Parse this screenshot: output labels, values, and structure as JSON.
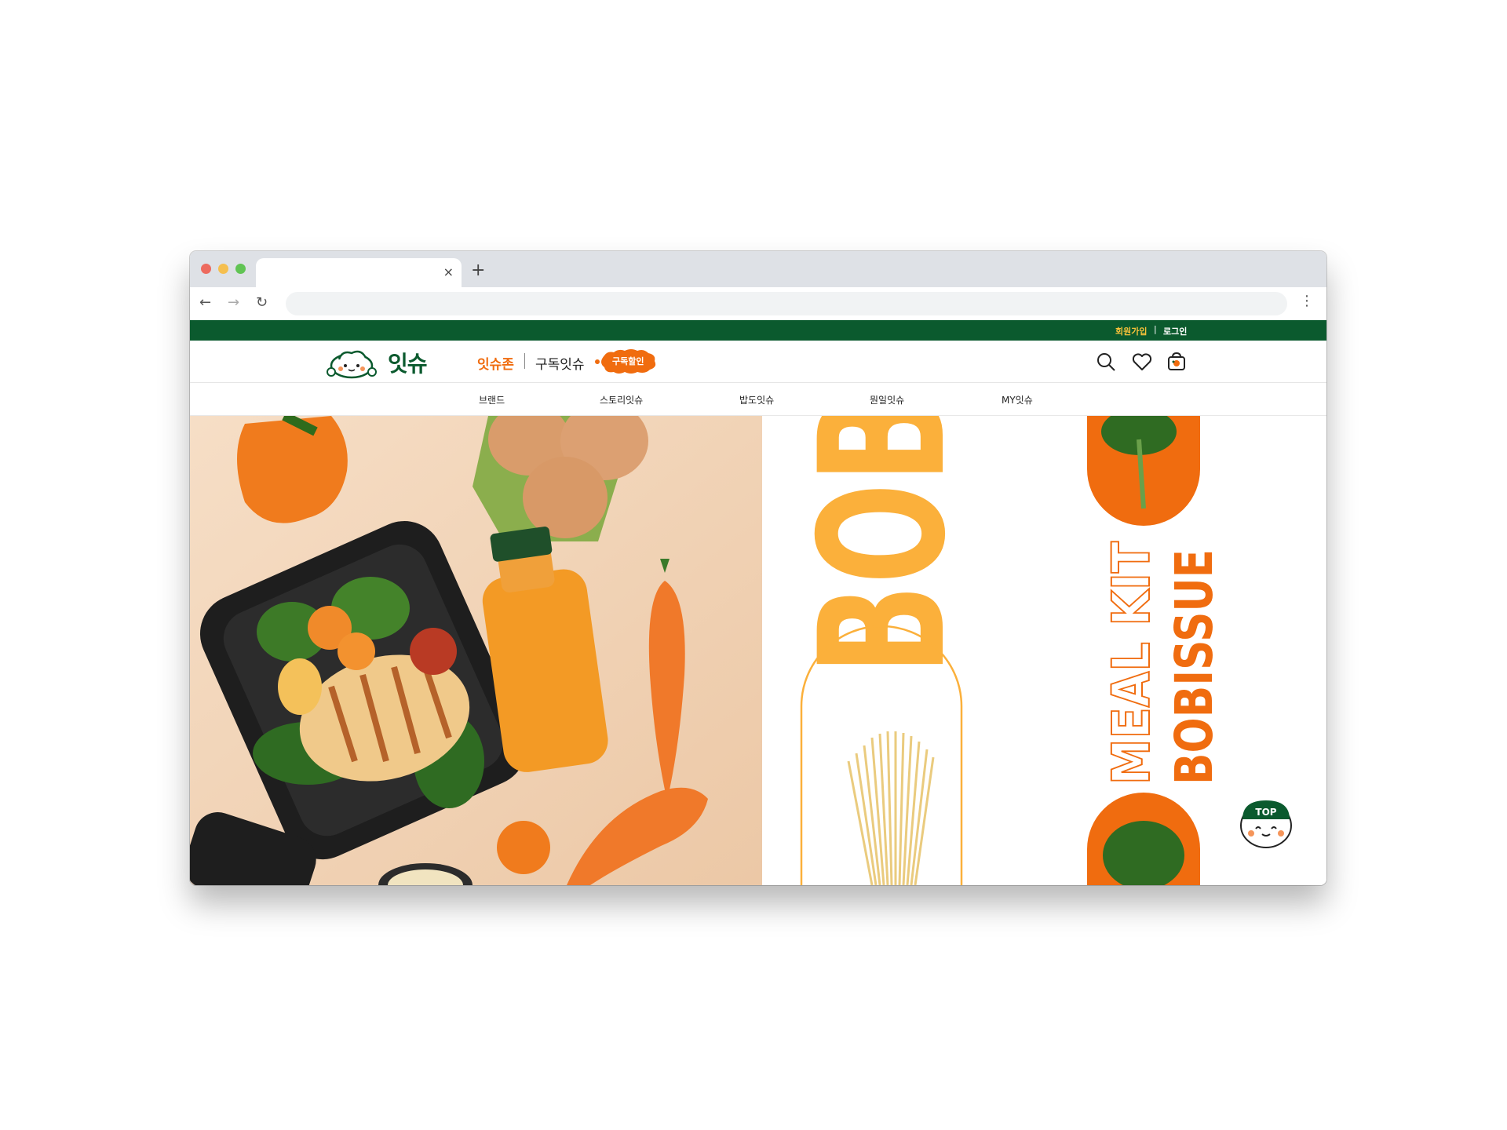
{
  "browser": {
    "tab_close": "×",
    "new_tab": "+",
    "nav": {
      "back": "←",
      "forward": "→",
      "reload": "↻",
      "menu": "⋮"
    },
    "dot_colors": [
      "#ed6a5e",
      "#f5bf4f",
      "#61c454"
    ]
  },
  "topbar": {
    "signup": "회원가입",
    "separator": "|",
    "login": "로그인"
  },
  "header": {
    "logo_text": "잇슈",
    "zone_link": "잇슈존",
    "subscribe_link": "구독잇슈",
    "badge_label": "구독할인",
    "icons": [
      "search-icon",
      "heart-icon",
      "cart-icon"
    ]
  },
  "menu": {
    "items": [
      "브랜드",
      "스토리잇슈",
      "밥도잇슈",
      "뭔일잇슈",
      "MY잇슈"
    ]
  },
  "hero": {
    "brand_big": "BOB",
    "vertical_text_1": "MEAL KIT",
    "vertical_text_2": "BOBISSUE"
  },
  "top_button": {
    "label": "TOP"
  },
  "colors": {
    "green": "#0b5a2e",
    "orange": "#f06c0f",
    "yellow": "#fbb03b"
  }
}
